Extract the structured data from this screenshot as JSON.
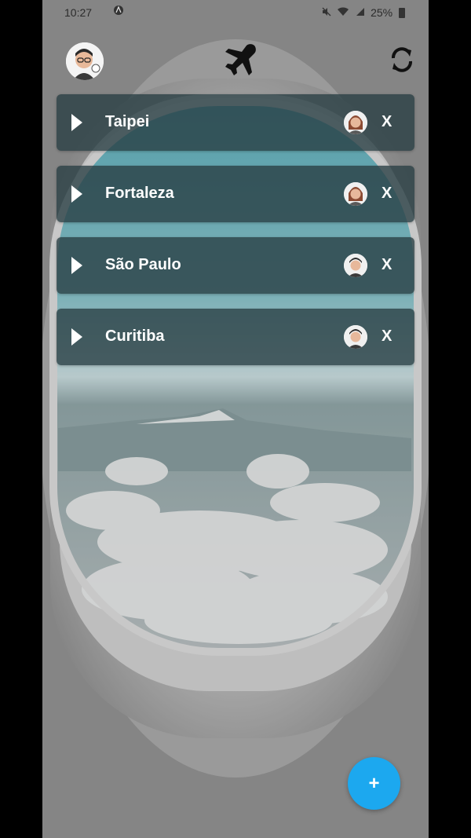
{
  "status_bar": {
    "time": "10:27",
    "battery": "25%"
  },
  "header": {
    "logo_icon": "airplane-icon",
    "refresh_icon": "refresh-icon"
  },
  "trips": [
    {
      "city": "Taipei",
      "remove_label": "X"
    },
    {
      "city": "Fortaleza",
      "remove_label": "X"
    },
    {
      "city": "São Paulo",
      "remove_label": "X"
    },
    {
      "city": "Curitiba",
      "remove_label": "X"
    }
  ],
  "fab": {
    "label": "+"
  },
  "colors": {
    "card": "#283e42",
    "fab": "#1ca8ef"
  }
}
